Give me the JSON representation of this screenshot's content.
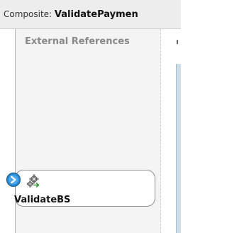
{
  "header": {
    "prefix": "Composite:",
    "name": "ValidatePaymen"
  },
  "panel": {
    "title": "External References"
  },
  "component": {
    "label": "ValidateBS",
    "icon": "gear-service-icon",
    "badge_icon": "chevron-right-icon",
    "badge_color": "#2a8bd4"
  }
}
